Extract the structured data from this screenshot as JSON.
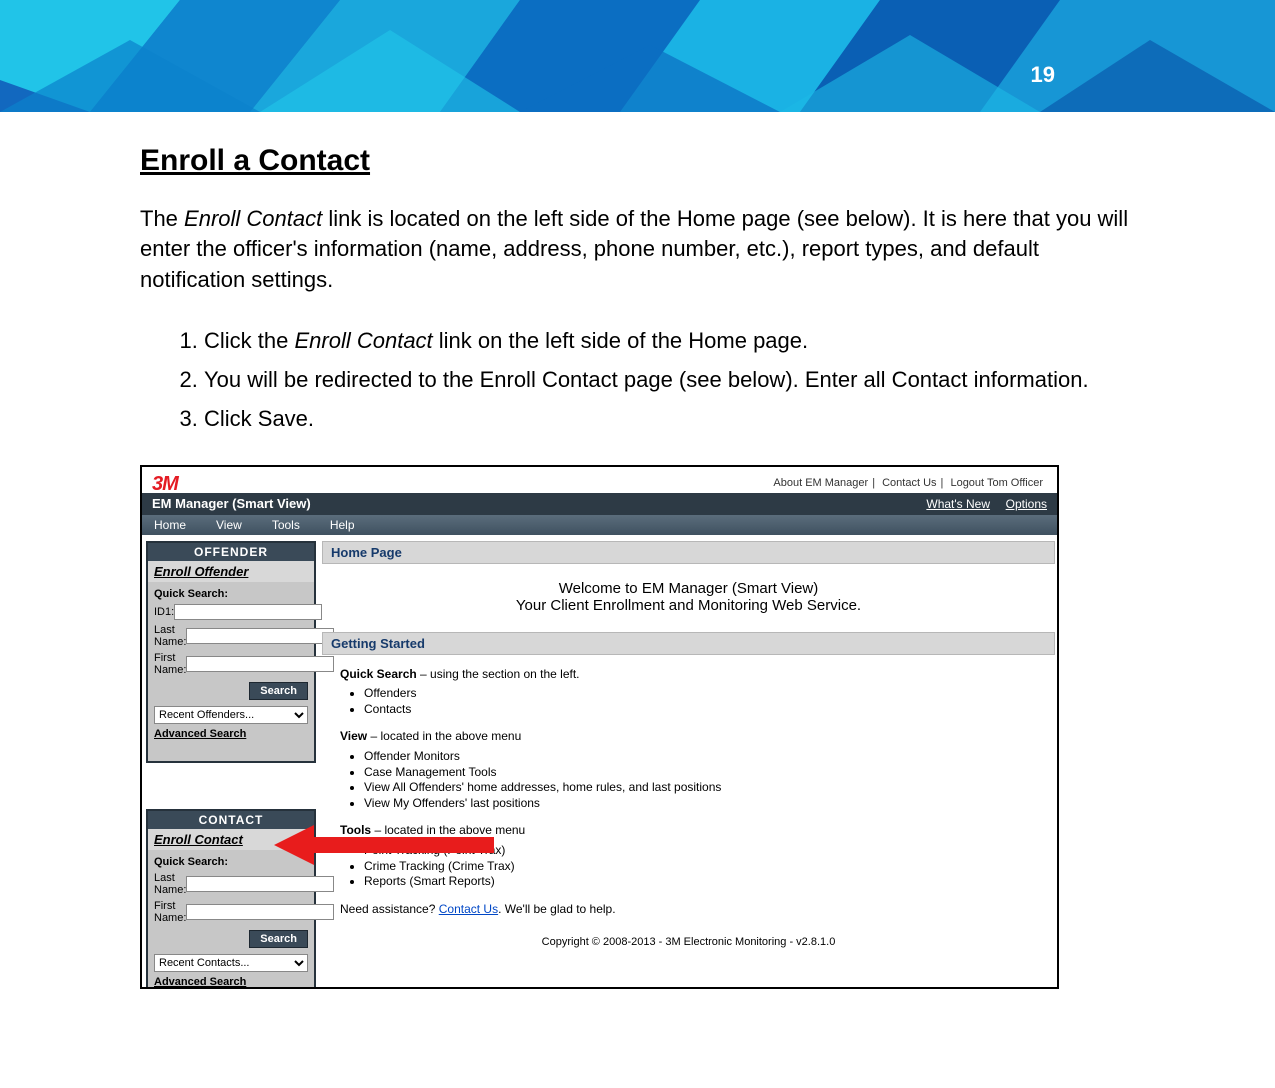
{
  "page_number": "19",
  "heading": "Enroll a Contact",
  "intro_before_link": "The ",
  "intro_link": "Enroll Contact",
  "intro_after_link": " link is located on the left side of the Home page (see below). It is here that you will enter the officer's information (name, address, phone number, etc.), report types, and default notification settings.",
  "steps": {
    "s1_before": "Click the ",
    "s1_ital": "Enroll Contact",
    "s1_after": " link on the left side of the Home page.",
    "s2": "You will be redirected to the Enroll Contact page (see below). Enter all Contact information.",
    "s3": "Click Save."
  },
  "screenshot": {
    "logo": "3M",
    "top_links": {
      "about": "About EM Manager",
      "contact": "Contact Us",
      "logout": "Logout Tom Officer"
    },
    "title": "EM Manager (Smart View)",
    "title_links": {
      "whats_new": "What's New",
      "options": "Options"
    },
    "menu": {
      "home": "Home",
      "view": "View",
      "tools": "Tools",
      "help": "Help"
    },
    "offender": {
      "hdr": "OFFENDER",
      "enroll": "Enroll Offender",
      "quick": "Quick Search:",
      "id1": "ID1:",
      "last": "Last Name:",
      "first": "First Name:",
      "search": "Search",
      "recent": "Recent Offenders...",
      "adv": "Advanced Search"
    },
    "contact": {
      "hdr": "CONTACT",
      "enroll": "Enroll Contact",
      "quick": "Quick Search:",
      "last": "Last Name:",
      "first": "First Name:",
      "search": "Search",
      "recent": "Recent Contacts...",
      "adv": "Advanced Search"
    },
    "main": {
      "homepage": "Home Page",
      "welcome1": "Welcome to EM Manager (Smart View)",
      "welcome2": "Your Client Enrollment and Monitoring Web Service.",
      "getting_started": "Getting Started",
      "qs_line_b": "Quick Search",
      "qs_line_rest": " – using the section on the left.",
      "qs_items": [
        "Offenders",
        "Contacts"
      ],
      "view_line_b": "View",
      "view_line_rest": " – located in the above menu",
      "view_items": [
        "Offender Monitors",
        "Case Management Tools",
        "View All Offenders' home addresses, home rules, and last positions",
        "View My Offenders' last positions"
      ],
      "tools_line_b": "Tools",
      "tools_line_rest": " – located in the above menu",
      "tools_items": [
        "Point Tracking (Point Trax)",
        "Crime Tracking (Crime Trax)",
        "Reports (Smart Reports)"
      ],
      "assist_before": "Need assistance? ",
      "assist_link": "Contact Us",
      "assist_after": ". We'll be glad to help.",
      "copyright": "Copyright © 2008-2013 - 3M Electronic Monitoring - v2.8.1.0"
    }
  }
}
